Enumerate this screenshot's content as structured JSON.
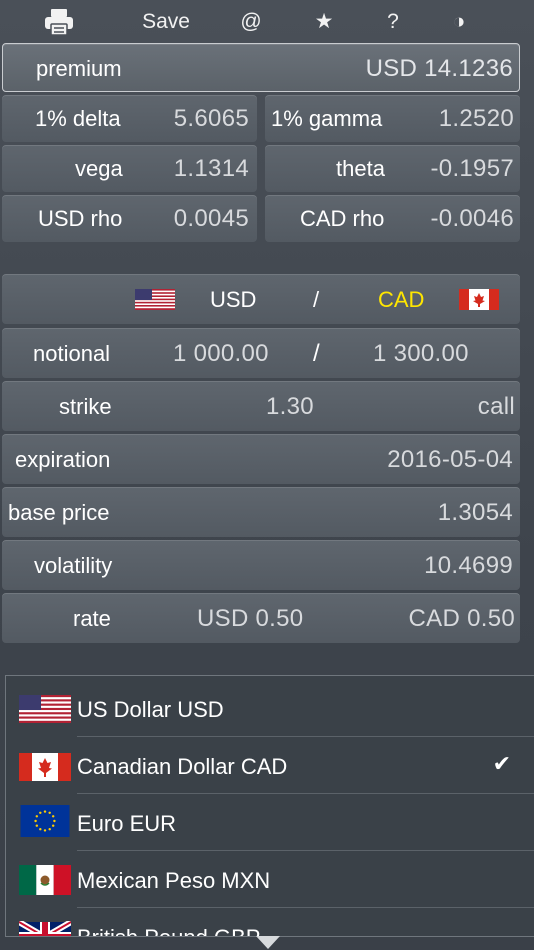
{
  "toolbar": {
    "print_icon": "printer-icon",
    "save_label": "Save",
    "email_label": "@",
    "favorite_label": "★",
    "help_label": "?",
    "theme_label": "◑"
  },
  "greeks": {
    "premium_label": "premium",
    "premium_value": "USD  14.1236",
    "delta_label": "1% delta",
    "delta_value": "5.6065",
    "gamma_label": "1% gamma",
    "gamma_value": "1.2520",
    "vega_label": "vega",
    "vega_value": "1.1314",
    "theta_label": "theta",
    "theta_value": "-0.1957",
    "usd_rho_label": "USD rho",
    "usd_rho_value": "0.0045",
    "cad_rho_label": "CAD rho",
    "cad_rho_value": "-0.0046"
  },
  "pair": {
    "base": "USD",
    "separator": "/",
    "quote": "CAD",
    "quote_color": "#ffe600"
  },
  "inputs": {
    "notional_label": "notional",
    "notional_base": "1 000.00",
    "notional_sep": "/",
    "notional_quote": "1 300.00",
    "strike_label": "strike",
    "strike_value": "1.30",
    "option_type": "call",
    "expiration_label": "expiration",
    "expiration_value": "2016-05-04",
    "base_price_label": "base price",
    "base_price_value": "1.3054",
    "volatility_label": "volatility",
    "volatility_value": "10.4699",
    "rate_label": "rate",
    "rate_base": "USD  0.50",
    "rate_quote": "CAD  0.50"
  },
  "currency_list": {
    "items": [
      {
        "name": "US Dollar USD",
        "flag": "us-flag-icon",
        "selected": false
      },
      {
        "name": "Canadian Dollar CAD",
        "flag": "ca-flag-icon",
        "selected": true
      },
      {
        "name": "Euro EUR",
        "flag": "eu-flag-icon",
        "selected": false
      },
      {
        "name": "Mexican Peso MXN",
        "flag": "mx-flag-icon",
        "selected": false
      },
      {
        "name": "British Pound GBP",
        "flag": "gb-flag-icon",
        "selected": false
      }
    ],
    "check_mark": "✔"
  }
}
